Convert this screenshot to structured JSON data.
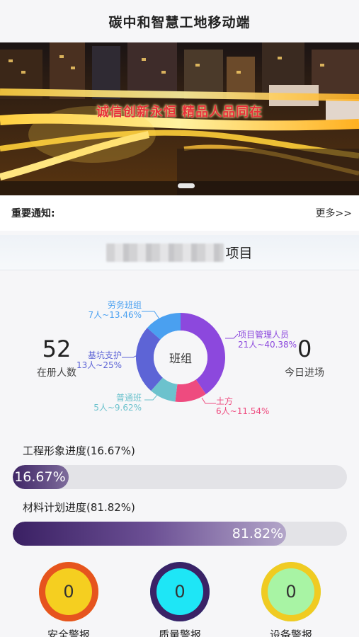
{
  "header": {
    "title": "碳中和智慧工地移动端"
  },
  "banner": {
    "slogan": "诚信创新永恒  精品人品同在"
  },
  "notice": {
    "label": "重要通知:",
    "more": "更多>>"
  },
  "project": {
    "suffix": "项目"
  },
  "stats": {
    "registered": {
      "value": "52",
      "caption": "在册人数"
    },
    "today": {
      "value": "0",
      "caption": "今日进场"
    }
  },
  "chart_data": {
    "type": "pie",
    "center_label": "班组",
    "slices": [
      {
        "name": "项目管理人员",
        "detail": "21人~40.38%",
        "count": 21,
        "percent": 40.38,
        "color": "#8c48dd"
      },
      {
        "name": "土方",
        "detail": "6人~11.54%",
        "count": 6,
        "percent": 11.54,
        "color": "#ee4b7f"
      },
      {
        "name": "普通班",
        "detail": "5人~9.62%",
        "count": 5,
        "percent": 9.62,
        "color": "#6cc2cd"
      },
      {
        "name": "基坑支护",
        "detail": "13人~25%",
        "count": 13,
        "percent": 25,
        "color": "#5d64d6"
      },
      {
        "name": "劳务班组",
        "detail": "7人~13.46%",
        "count": 7,
        "percent": 13.46,
        "color": "#4aa0f0"
      }
    ]
  },
  "progress": {
    "image": {
      "title": "工程形象进度(16.67%)",
      "label": "16.67%",
      "value": 16.67
    },
    "material": {
      "title": "材料计划进度(81.82%)",
      "label": "81.82%",
      "value": 81.82
    }
  },
  "alarms": [
    {
      "value": "0",
      "caption": "安全警报",
      "fill": "#f5cf20",
      "ring": "#e6541e"
    },
    {
      "value": "0",
      "caption": "质量警报",
      "fill": "#1ee6f6",
      "ring": "#3a2266"
    },
    {
      "value": "0",
      "caption": "设备警报",
      "fill": "#a8f4a4",
      "ring": "#f0cb22"
    }
  ]
}
